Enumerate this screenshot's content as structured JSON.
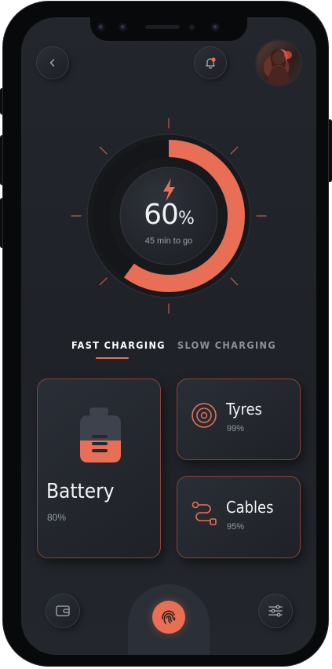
{
  "colors": {
    "accent": "#e86f55",
    "background": "#1f2228",
    "card_border": "#8a4538"
  },
  "header": {
    "back_icon": "chevron-left-icon",
    "notification_icon": "bell-icon",
    "avatar": "user-avatar"
  },
  "gauge": {
    "level": 0.6,
    "value": "60",
    "unit": "%",
    "subtitle": "45 min to go",
    "icon": "lightning-bolt-icon"
  },
  "tabs": [
    {
      "label": "FAST CHARGING",
      "active": true
    },
    {
      "label": "SLOW CHARGING",
      "active": false
    }
  ],
  "cards": {
    "battery": {
      "title": "Battery",
      "value": "80%",
      "icon": "battery-icon"
    },
    "tyres": {
      "title": "Tyres",
      "value": "99%",
      "icon": "target-icon"
    },
    "cables": {
      "title": "Cables",
      "value": "95%",
      "icon": "route-icon"
    }
  },
  "bottom_nav": {
    "left_icon": "wallet-icon",
    "center_icon": "fingerprint-icon",
    "right_icon": "sliders-icon"
  }
}
